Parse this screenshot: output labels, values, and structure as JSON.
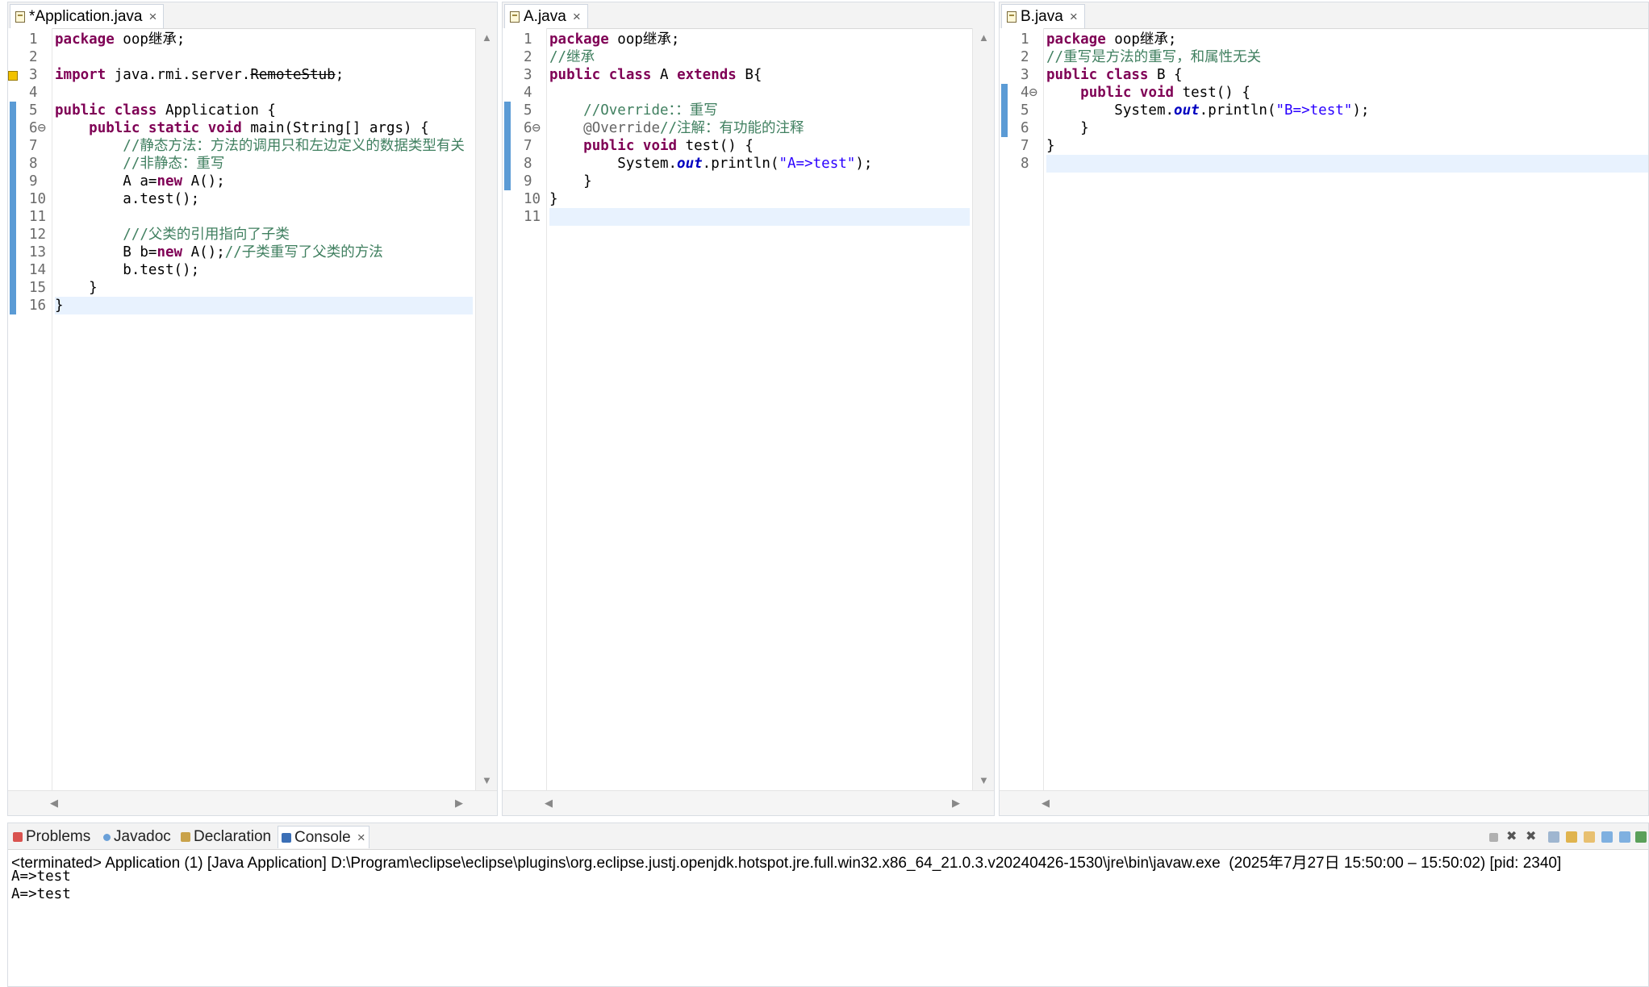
{
  "editors": [
    {
      "tab_label": "*Application.java",
      "close": "×",
      "current_line": 16,
      "lines": [
        {
          "n": "1",
          "tokens": [
            {
              "t": "package",
              "c": "kw"
            },
            {
              "t": " oop继承;"
            }
          ]
        },
        {
          "n": "2",
          "tokens": []
        },
        {
          "n": "3",
          "tokens": [
            {
              "t": "import",
              "c": "kw"
            },
            {
              "t": " java.rmi.server."
            },
            {
              "t": "RemoteStub",
              "c": "strike"
            },
            {
              "t": ";"
            }
          ]
        },
        {
          "n": "4",
          "tokens": []
        },
        {
          "n": "5",
          "tokens": [
            {
              "t": "public",
              "c": "kw"
            },
            {
              "t": " "
            },
            {
              "t": "class",
              "c": "kw"
            },
            {
              "t": " Application {"
            }
          ]
        },
        {
          "n": "6⊖",
          "tokens": [
            {
              "t": "    "
            },
            {
              "t": "public",
              "c": "kw"
            },
            {
              "t": " "
            },
            {
              "t": "static",
              "c": "kw"
            },
            {
              "t": " "
            },
            {
              "t": "void",
              "c": "kw"
            },
            {
              "t": " main(String[] args) {"
            }
          ]
        },
        {
          "n": "7",
          "tokens": [
            {
              "t": "        "
            },
            {
              "t": "//静态方法：方法的调用只和左边定义的数据类型有关",
              "c": "cm"
            }
          ]
        },
        {
          "n": "8",
          "tokens": [
            {
              "t": "        "
            },
            {
              "t": "//非静态：重写",
              "c": "cm"
            }
          ]
        },
        {
          "n": "9",
          "tokens": [
            {
              "t": "        A a="
            },
            {
              "t": "new",
              "c": "kw"
            },
            {
              "t": " A();"
            }
          ]
        },
        {
          "n": "10",
          "tokens": [
            {
              "t": "        a.test();"
            }
          ]
        },
        {
          "n": "11",
          "tokens": []
        },
        {
          "n": "12",
          "tokens": [
            {
              "t": "        "
            },
            {
              "t": "///父类的引用指向了子类",
              "c": "cm"
            }
          ]
        },
        {
          "n": "13",
          "tokens": [
            {
              "t": "        B b="
            },
            {
              "t": "new",
              "c": "kw"
            },
            {
              "t": " A();"
            },
            {
              "t": "//子类重写了父类的方法",
              "c": "cm"
            }
          ]
        },
        {
          "n": "14",
          "tokens": [
            {
              "t": "        b.test();"
            }
          ]
        },
        {
          "n": "15",
          "tokens": [
            {
              "t": "    }"
            }
          ]
        },
        {
          "n": "16",
          "tokens": [
            {
              "t": "}"
            }
          ]
        }
      ]
    },
    {
      "tab_label": "A.java",
      "close": "×",
      "current_line": 11,
      "lines": [
        {
          "n": "1",
          "tokens": [
            {
              "t": "package",
              "c": "kw"
            },
            {
              "t": " oop继承;"
            }
          ]
        },
        {
          "n": "2",
          "tokens": [
            {
              "t": "//继承",
              "c": "cm"
            }
          ]
        },
        {
          "n": "3",
          "tokens": [
            {
              "t": "public",
              "c": "kw"
            },
            {
              "t": " "
            },
            {
              "t": "class",
              "c": "kw"
            },
            {
              "t": " A "
            },
            {
              "t": "extends",
              "c": "kw"
            },
            {
              "t": " B{"
            }
          ]
        },
        {
          "n": "4",
          "tokens": []
        },
        {
          "n": "5",
          "tokens": [
            {
              "t": "    "
            },
            {
              "t": "//Override：：重写",
              "c": "cm"
            }
          ]
        },
        {
          "n": "6⊖",
          "tokens": [
            {
              "t": "    "
            },
            {
              "t": "@Override",
              "c": "ann"
            },
            {
              "t": "//注解：有功能的注释",
              "c": "cm"
            }
          ]
        },
        {
          "n": "7",
          "tokens": [
            {
              "t": "    "
            },
            {
              "t": "public",
              "c": "kw"
            },
            {
              "t": " "
            },
            {
              "t": "void",
              "c": "kw"
            },
            {
              "t": " test() {"
            }
          ]
        },
        {
          "n": "8",
          "tokens": [
            {
              "t": "        System."
            },
            {
              "t": "out",
              "c": "st"
            },
            {
              "t": ".println("
            },
            {
              "t": "\"A=>test\"",
              "c": "str"
            },
            {
              "t": ");"
            }
          ]
        },
        {
          "n": "9",
          "tokens": [
            {
              "t": "    }"
            }
          ]
        },
        {
          "n": "10",
          "tokens": [
            {
              "t": "}"
            }
          ]
        },
        {
          "n": "11",
          "tokens": []
        }
      ]
    },
    {
      "tab_label": "B.java",
      "close": "×",
      "current_line": 8,
      "lines": [
        {
          "n": "1",
          "tokens": [
            {
              "t": "package",
              "c": "kw"
            },
            {
              "t": " oop继承;"
            }
          ]
        },
        {
          "n": "2",
          "tokens": [
            {
              "t": "//重写是方法的重写，和属性无关",
              "c": "cm"
            }
          ]
        },
        {
          "n": "3",
          "tokens": [
            {
              "t": "public",
              "c": "kw"
            },
            {
              "t": " "
            },
            {
              "t": "class",
              "c": "kw"
            },
            {
              "t": " B {"
            }
          ]
        },
        {
          "n": "4⊖",
          "tokens": [
            {
              "t": "    "
            },
            {
              "t": "public",
              "c": "kw"
            },
            {
              "t": " "
            },
            {
              "t": "void",
              "c": "kw"
            },
            {
              "t": " test() {"
            }
          ]
        },
        {
          "n": "5",
          "tokens": [
            {
              "t": "        System."
            },
            {
              "t": "out",
              "c": "st"
            },
            {
              "t": ".println("
            },
            {
              "t": "\"B=>test\"",
              "c": "str"
            },
            {
              "t": ");"
            }
          ]
        },
        {
          "n": "6",
          "tokens": [
            {
              "t": "    }"
            }
          ]
        },
        {
          "n": "7",
          "tokens": [
            {
              "t": "}"
            }
          ]
        },
        {
          "n": "8",
          "tokens": []
        }
      ]
    }
  ],
  "console": {
    "tabs": [
      {
        "label": "Problems",
        "icon": "problems-icon"
      },
      {
        "label": "Javadoc",
        "icon": "javadoc-icon"
      },
      {
        "label": "Declaration",
        "icon": "declaration-icon"
      },
      {
        "label": "Console",
        "icon": "console-icon",
        "active": true,
        "close": "×"
      }
    ],
    "header": "<terminated> Application (1) [Java Application] D:\\Program\\eclipse\\eclipse\\plugins\\org.eclipse.justj.openjdk.hotspot.jre.full.win32.x86_64_21.0.3.v20240426-1530\\jre\\bin\\javaw.exe  (2025年7月27日 15:50:00 – 15:50:02) [pid: 2340]",
    "output": [
      "A=>test",
      "A=>test"
    ]
  },
  "colors": {
    "keyword": "#7f0055",
    "comment": "#3f7f5f",
    "string": "#2a00ff",
    "static_field": "#0000c0",
    "current_line": "#e8f2fe",
    "change_bar": "#5b9bd5"
  }
}
